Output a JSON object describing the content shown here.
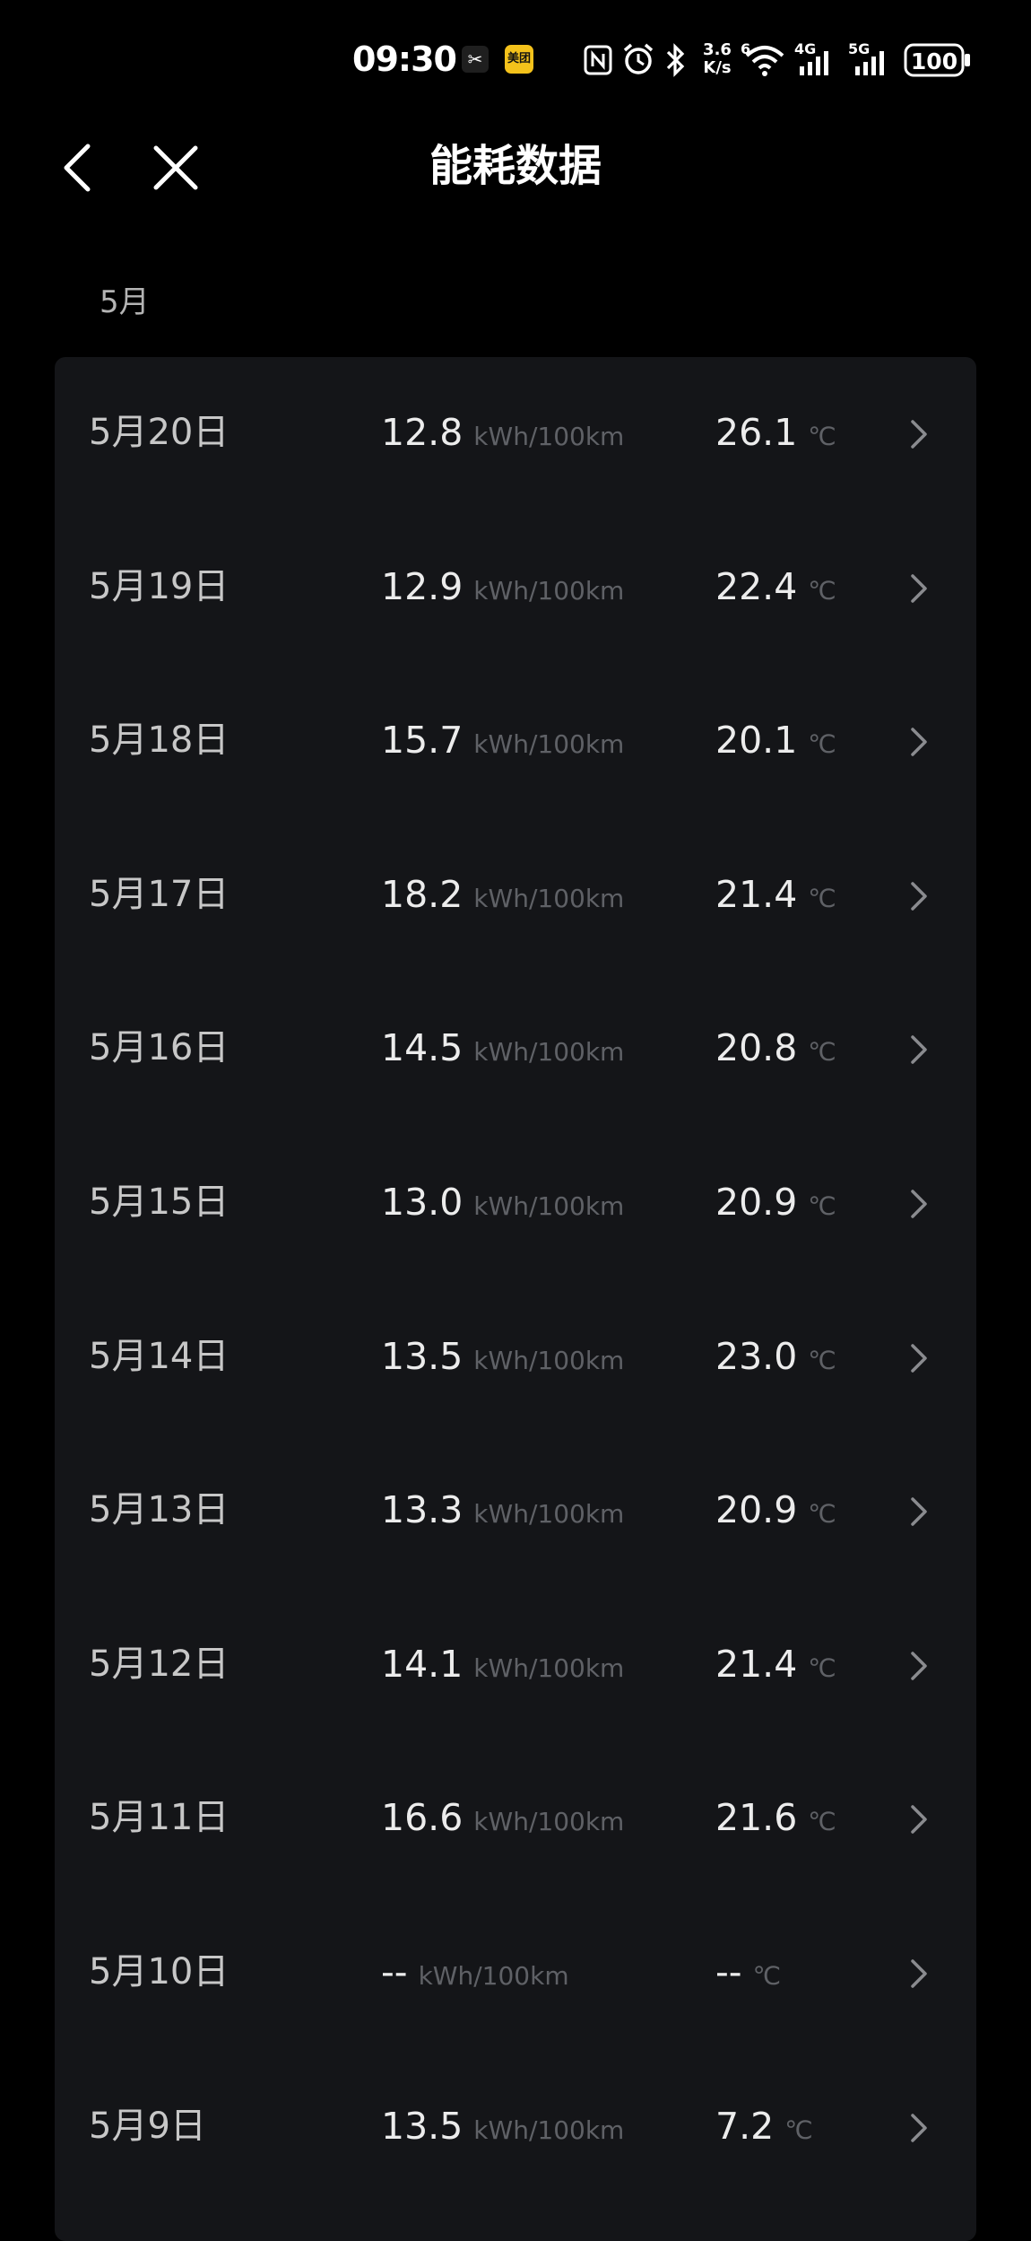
{
  "status_bar": {
    "time": "09:30",
    "app1_icon": "scissors-icon",
    "app2_icon": "meituan-icon",
    "app2_label": "美团",
    "speed_value": "3.6",
    "speed_unit": "K/s",
    "wifi_label": "6",
    "signal1_label": "4G",
    "signal2_label": "5G",
    "battery": "100"
  },
  "header": {
    "title": "能耗数据",
    "back_icon": "chevron-left-icon",
    "close_icon": "close-icon"
  },
  "month": "5月",
  "rows": [
    {
      "date": "5月20日",
      "energy": "12.8",
      "energy_unit": "kWh/100km",
      "temp": "26.1",
      "temp_unit": "℃"
    },
    {
      "date": "5月19日",
      "energy": "12.9",
      "energy_unit": "kWh/100km",
      "temp": "22.4",
      "temp_unit": "℃"
    },
    {
      "date": "5月18日",
      "energy": "15.7",
      "energy_unit": "kWh/100km",
      "temp": "20.1",
      "temp_unit": "℃"
    },
    {
      "date": "5月17日",
      "energy": "18.2",
      "energy_unit": "kWh/100km",
      "temp": "21.4",
      "temp_unit": "℃"
    },
    {
      "date": "5月16日",
      "energy": "14.5",
      "energy_unit": "kWh/100km",
      "temp": "20.8",
      "temp_unit": "℃"
    },
    {
      "date": "5月15日",
      "energy": "13.0",
      "energy_unit": "kWh/100km",
      "temp": "20.9",
      "temp_unit": "℃"
    },
    {
      "date": "5月14日",
      "energy": "13.5",
      "energy_unit": "kWh/100km",
      "temp": "23.0",
      "temp_unit": "℃"
    },
    {
      "date": "5月13日",
      "energy": "13.3",
      "energy_unit": "kWh/100km",
      "temp": "20.9",
      "temp_unit": "℃"
    },
    {
      "date": "5月12日",
      "energy": "14.1",
      "energy_unit": "kWh/100km",
      "temp": "21.4",
      "temp_unit": "℃"
    },
    {
      "date": "5月11日",
      "energy": "16.6",
      "energy_unit": "kWh/100km",
      "temp": "21.6",
      "temp_unit": "℃"
    },
    {
      "date": "5月10日",
      "energy": "--",
      "energy_unit": "kWh/100km",
      "temp": "--",
      "temp_unit": "℃"
    },
    {
      "date": "5月9日",
      "energy": "13.5",
      "energy_unit": "kWh/100km",
      "temp": "7.2",
      "temp_unit": "℃"
    }
  ]
}
